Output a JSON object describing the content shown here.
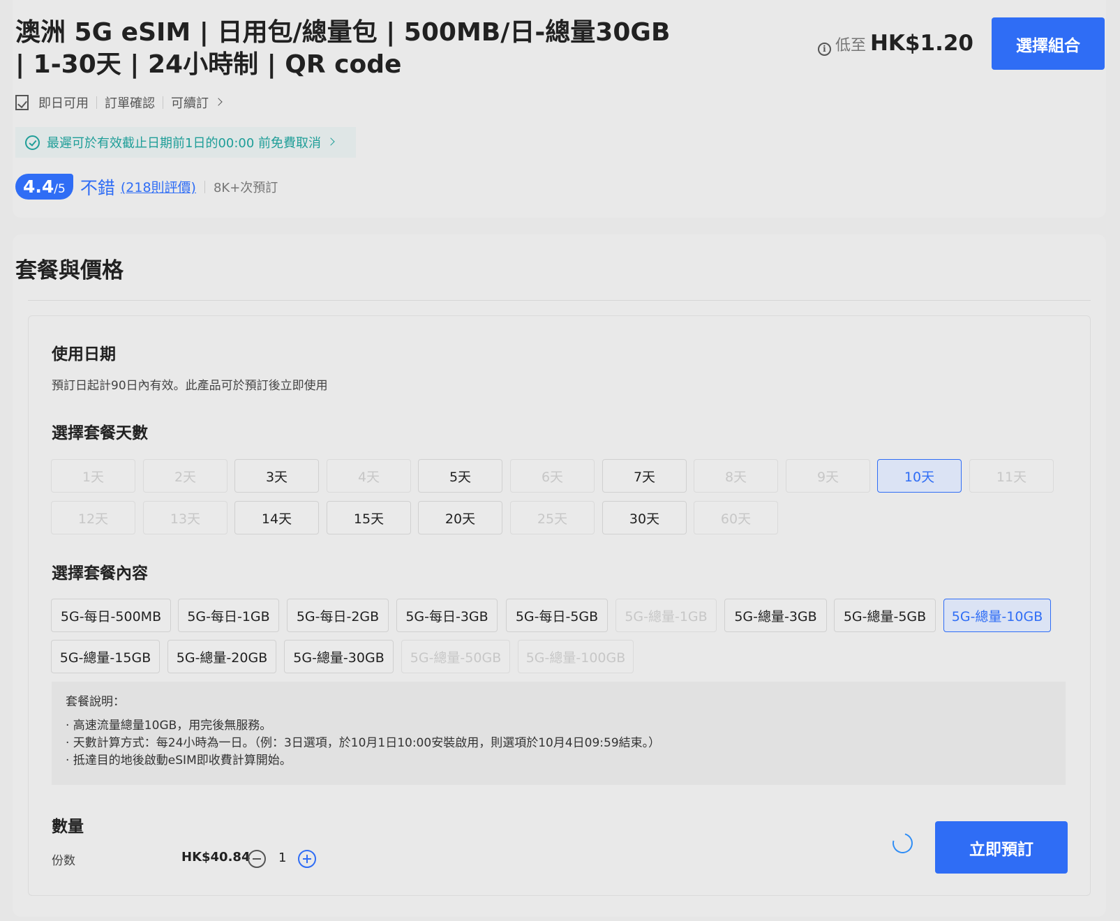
{
  "header": {
    "title": "澳洲 5G eSIM | 日用包/總量包 | 500MB/日-總量30GB | 1-30天 | 24小時制 | QR code",
    "price_prefix": "低至",
    "price": "HK$1.20",
    "choose_button": "選擇組合",
    "features": [
      "即日可用",
      "訂單確認",
      "可續訂"
    ],
    "cancel_policy": "最遲可於有效截止日期前1日的00:00 前免費取消",
    "rating": {
      "score": "4.4",
      "max": "/5",
      "word": "不錯",
      "reviews": "(218則評價)",
      "booked": "8K+次預訂"
    }
  },
  "packages": {
    "title": "套餐與價格",
    "usage_date": {
      "heading": "使用日期",
      "description": "預訂日起計90日內有效。此產品可於預訂後立即使用"
    },
    "days": {
      "heading": "選擇套餐天數",
      "options": [
        {
          "label": "1天",
          "state": "disabled"
        },
        {
          "label": "2天",
          "state": "disabled"
        },
        {
          "label": "3天",
          "state": "enabled"
        },
        {
          "label": "4天",
          "state": "disabled"
        },
        {
          "label": "5天",
          "state": "enabled"
        },
        {
          "label": "6天",
          "state": "disabled"
        },
        {
          "label": "7天",
          "state": "enabled"
        },
        {
          "label": "8天",
          "state": "disabled"
        },
        {
          "label": "9天",
          "state": "disabled"
        },
        {
          "label": "10天",
          "state": "selected"
        },
        {
          "label": "11天",
          "state": "disabled"
        },
        {
          "label": "12天",
          "state": "disabled"
        },
        {
          "label": "13天",
          "state": "disabled"
        },
        {
          "label": "14天",
          "state": "enabled"
        },
        {
          "label": "15天",
          "state": "enabled"
        },
        {
          "label": "20天",
          "state": "enabled"
        },
        {
          "label": "25天",
          "state": "disabled"
        },
        {
          "label": "30天",
          "state": "enabled"
        },
        {
          "label": "60天",
          "state": "disabled"
        }
      ]
    },
    "content": {
      "heading": "選擇套餐內容",
      "options": [
        {
          "label": "5G-每日-500MB",
          "state": "enabled"
        },
        {
          "label": "5G-每日-1GB",
          "state": "enabled"
        },
        {
          "label": "5G-每日-2GB",
          "state": "enabled"
        },
        {
          "label": "5G-每日-3GB",
          "state": "enabled"
        },
        {
          "label": "5G-每日-5GB",
          "state": "enabled"
        },
        {
          "label": "5G-總量-1GB",
          "state": "disabled"
        },
        {
          "label": "5G-總量-3GB",
          "state": "enabled"
        },
        {
          "label": "5G-總量-5GB",
          "state": "enabled"
        },
        {
          "label": "5G-總量-10GB",
          "state": "selected"
        },
        {
          "label": "5G-總量-15GB",
          "state": "enabled"
        },
        {
          "label": "5G-總量-20GB",
          "state": "enabled"
        },
        {
          "label": "5G-總量-30GB",
          "state": "enabled"
        },
        {
          "label": "5G-總量-50GB",
          "state": "disabled"
        },
        {
          "label": "5G-總量-100GB",
          "state": "disabled"
        }
      ]
    },
    "notes": {
      "title": "套餐說明：",
      "lines": [
        "· 高速流量總量10GB，用完後無服務。",
        "· 天數計算方式：每24小時為一日。（例：3日選項，於10月1日10:00安裝啟用，則選項於10月4日09:59結束。）",
        "· 抵達目的地後啟動eSIM即收費計算開始。"
      ]
    },
    "quantity": {
      "heading": "數量",
      "unit_label": "份数",
      "price": "HK$40.84",
      "value": "1"
    },
    "book_button": "立即預訂"
  }
}
